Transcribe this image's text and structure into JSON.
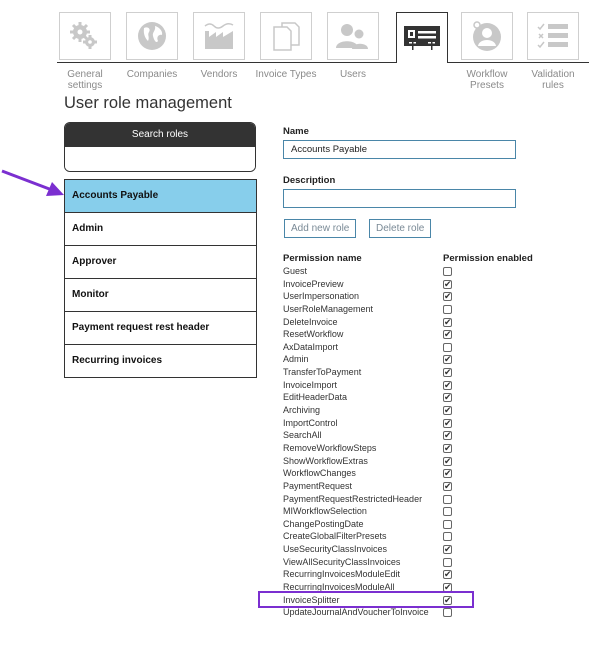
{
  "tabs": [
    {
      "label": "General settings",
      "icon": "gears-icon",
      "active": false
    },
    {
      "label": "Companies",
      "icon": "globe-icon",
      "active": false
    },
    {
      "label": "Vendors",
      "icon": "factory-icon",
      "active": false
    },
    {
      "label": "Invoice Types",
      "icon": "documents-icon",
      "active": false
    },
    {
      "label": "Users",
      "icon": "users-icon",
      "active": false
    },
    {
      "label": "",
      "icon": "id-card-icon",
      "active": true
    },
    {
      "label": "Workflow Presets",
      "icon": "user-circle-icon",
      "active": false
    },
    {
      "label": "Validation rules",
      "icon": "checklist-icon",
      "active": false
    }
  ],
  "page": {
    "title": "User role management"
  },
  "search": {
    "header": "Search roles",
    "value": "",
    "placeholder": ""
  },
  "roles": [
    {
      "label": "Accounts Payable",
      "selected": true
    },
    {
      "label": "Admin",
      "selected": false
    },
    {
      "label": "Approver",
      "selected": false
    },
    {
      "label": "Monitor",
      "selected": false
    },
    {
      "label": "Payment request rest header",
      "selected": false
    },
    {
      "label": "Recurring invoices",
      "selected": false
    }
  ],
  "form": {
    "name_label": "Name",
    "name_value": "Accounts Payable",
    "description_label": "Description",
    "description_value": "",
    "add_button": "Add new role",
    "delete_button": "Delete role"
  },
  "permissions": {
    "name_header": "Permission name",
    "enabled_header": "Permission enabled",
    "items": [
      {
        "name": "Guest",
        "enabled": false
      },
      {
        "name": "InvoicePreview",
        "enabled": true
      },
      {
        "name": "UserImpersonation",
        "enabled": true
      },
      {
        "name": "UserRoleManagement",
        "enabled": false
      },
      {
        "name": "DeleteInvoice",
        "enabled": true
      },
      {
        "name": "ResetWorkflow",
        "enabled": true
      },
      {
        "name": "AxDataImport",
        "enabled": false
      },
      {
        "name": "Admin",
        "enabled": true
      },
      {
        "name": "TransferToPayment",
        "enabled": true
      },
      {
        "name": "InvoiceImport",
        "enabled": true
      },
      {
        "name": "EditHeaderData",
        "enabled": true
      },
      {
        "name": "Archiving",
        "enabled": true
      },
      {
        "name": "ImportControl",
        "enabled": true
      },
      {
        "name": "SearchAll",
        "enabled": true
      },
      {
        "name": "RemoveWorkflowSteps",
        "enabled": true
      },
      {
        "name": "ShowWorkflowExtras",
        "enabled": true
      },
      {
        "name": "WorkflowChanges",
        "enabled": true
      },
      {
        "name": "PaymentRequest",
        "enabled": true
      },
      {
        "name": "PaymentRequestRestrictedHeader",
        "enabled": false
      },
      {
        "name": "MIWorkflowSelection",
        "enabled": false
      },
      {
        "name": "ChangePostingDate",
        "enabled": false
      },
      {
        "name": "CreateGlobalFilterPresets",
        "enabled": false
      },
      {
        "name": "UseSecurityClassInvoices",
        "enabled": true
      },
      {
        "name": "ViewAllSecurityClassInvoices",
        "enabled": false
      },
      {
        "name": "RecurringInvoicesModuleEdit",
        "enabled": true
      },
      {
        "name": "RecurringInvoicesModuleAll",
        "enabled": true
      },
      {
        "name": "InvoiceSplitter",
        "enabled": true
      },
      {
        "name": "UpdateJournalAndVoucherToInvoice",
        "enabled": false
      }
    ]
  },
  "annotations": {
    "arrow_color": "#7b2fd0",
    "highlight_color": "#7b2fd0",
    "highlighted_permission": "InvoiceSplitter",
    "arrow_target": "Accounts Payable"
  },
  "colors": {
    "selected_role_bg": "#87ceeb",
    "header_dark": "#333333",
    "input_border": "#4a86a8"
  }
}
